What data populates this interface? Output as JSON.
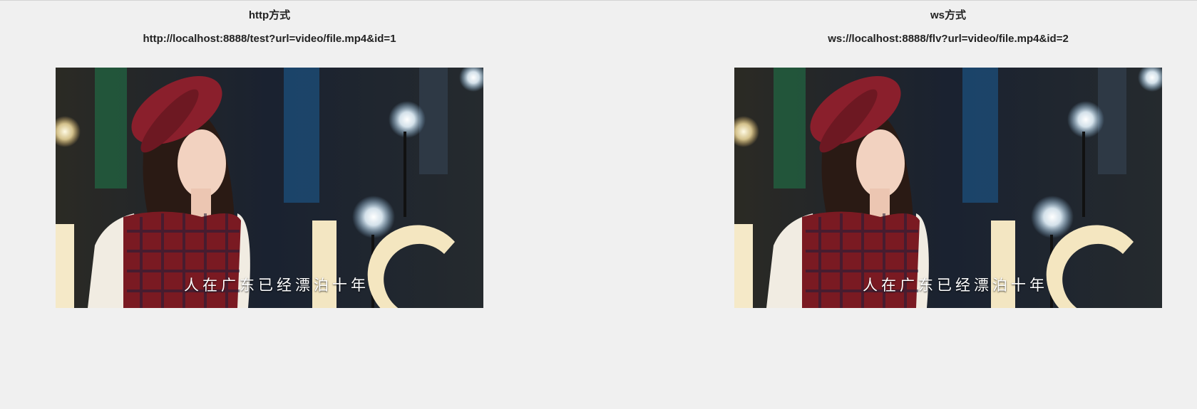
{
  "players": [
    {
      "title": "http方式",
      "url": "http://localhost:8888/test?url=video/file.mp4&id=1",
      "subtitle": "人在广东已经漂泊十年"
    },
    {
      "title": "ws方式",
      "url": "ws://localhost:8888/flv?url=video/file.mp4&id=2",
      "subtitle": "人在广东已经漂泊十年"
    }
  ],
  "colors": {
    "page_background": "#f0f0f0",
    "text": "#222222",
    "hat": "#8a1f2c",
    "plaid": "#7a1a22"
  }
}
